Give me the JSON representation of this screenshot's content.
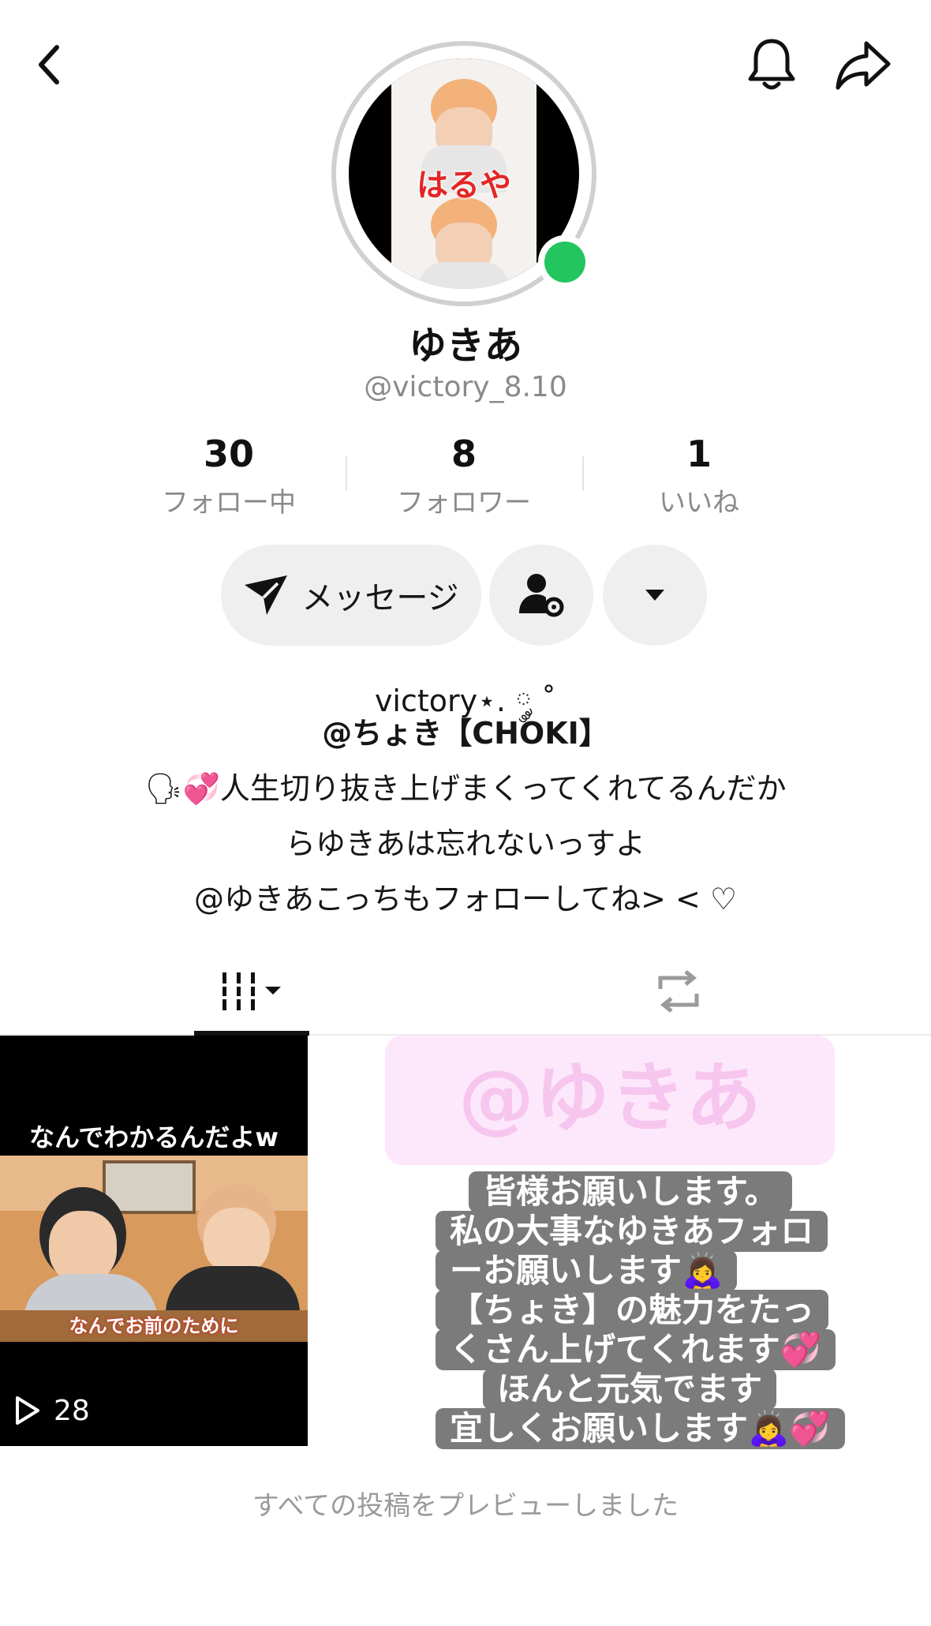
{
  "profile": {
    "display_name": "ゆきあ",
    "username": "@victory_8.10",
    "avatar_caption": "はるや",
    "online": true
  },
  "stats": [
    {
      "value": "30",
      "label": "フォロー中"
    },
    {
      "value": "8",
      "label": "フォロワー"
    },
    {
      "value": "1",
      "label": "いいね"
    }
  ],
  "actions": {
    "message_label": "メッセージ"
  },
  "bio": {
    "line1": "victory⋆. ༘ ˚",
    "line2": "@ちょき【CHOKI】",
    "line3": "🗣💞人生切り抜き上げまくってくれてるんだか",
    "line4": "らゆきあは忘れないっすよ",
    "line5": "@ゆきあこっちもフォローしてね> < ♡"
  },
  "tabs": [
    {
      "name": "videos",
      "icon": "grid-bars-icon",
      "active": true
    },
    {
      "name": "reposts",
      "icon": "repost-icon",
      "active": false
    }
  ],
  "video": {
    "caption_top": "なんでわかるんだよw",
    "caption_bottom": "なんでお前のために",
    "views": "28"
  },
  "story": {
    "mention": "@ゆきあ",
    "lines": [
      "皆様お願いします。",
      "私の大事なゆきあフォロ",
      "ーお願いします🙇‍♀️",
      "【ちょき】の魅力をたっ",
      "くさん上げてくれます💞",
      "ほんと元気でます",
      "宜しくお願いします🙇‍♀️💞"
    ]
  },
  "footer": {
    "note": "すべての投稿をプレビューしました"
  },
  "colors": {
    "online": "#22c55e",
    "pill_bg": "#efefef",
    "muted_text": "#8a8a8a",
    "sticker_bg": "#7b7b7b",
    "mention_bg": "#fde8fb",
    "mention_text": "#f7c6ef",
    "avatar_caption": "#e52525"
  }
}
